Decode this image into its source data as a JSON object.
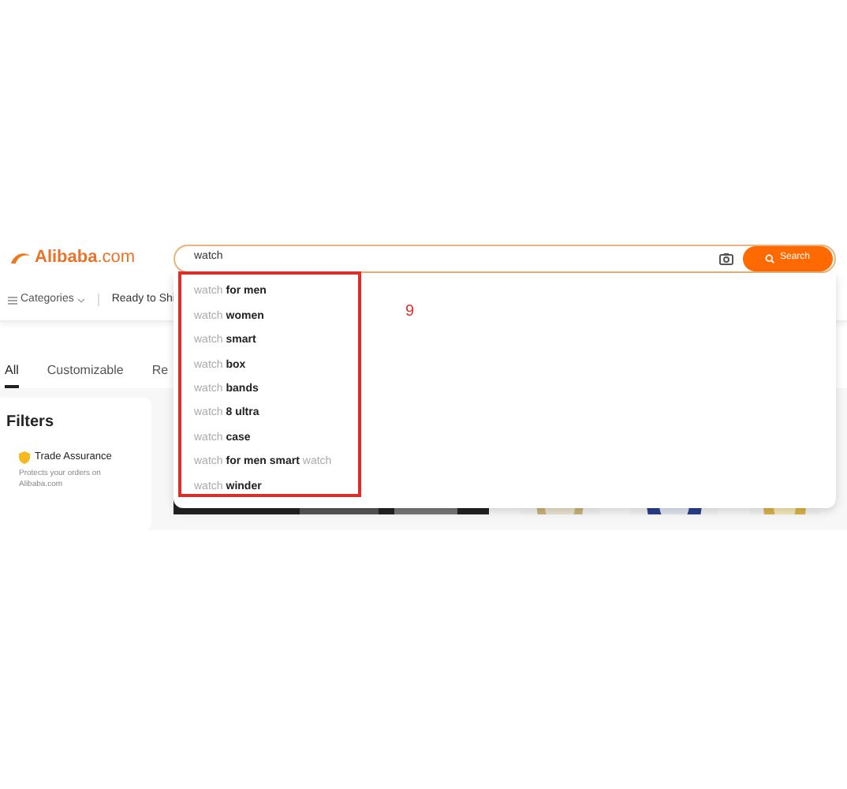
{
  "header": {
    "logo": "**Alibaba**.com",
    "search": {
      "value": "watch",
      "button": "Search"
    }
  },
  "nav": {
    "categories": "Categories",
    "ready_to_ship": "Ready to Shi"
  },
  "tabs": [
    {
      "label": "All",
      "selected": true
    },
    {
      "label": "Customizable",
      "selected": false
    },
    {
      "label": "Re",
      "selected": false
    }
  ],
  "filters": {
    "title": "Filters",
    "trade_assurance": "Trade Assurance",
    "note": "Protects your orders on Alibaba.com"
  },
  "suggestions": [
    {
      "typed": "watch",
      "completion": "for men"
    },
    {
      "typed": "watch",
      "completion": "women"
    },
    {
      "typed": "watch",
      "completion": "smart"
    },
    {
      "typed": "watch",
      "completion": "box"
    },
    {
      "typed": "watch",
      "completion": "bands"
    },
    {
      "typed": "watch",
      "completion": "8 ultra"
    },
    {
      "typed": "watch",
      "completion": "case"
    },
    {
      "typed": "watch",
      "completion": "for men smart",
      "tail": "watch"
    },
    {
      "typed": "watch",
      "completion": "winder"
    }
  ],
  "annotation": "9"
}
